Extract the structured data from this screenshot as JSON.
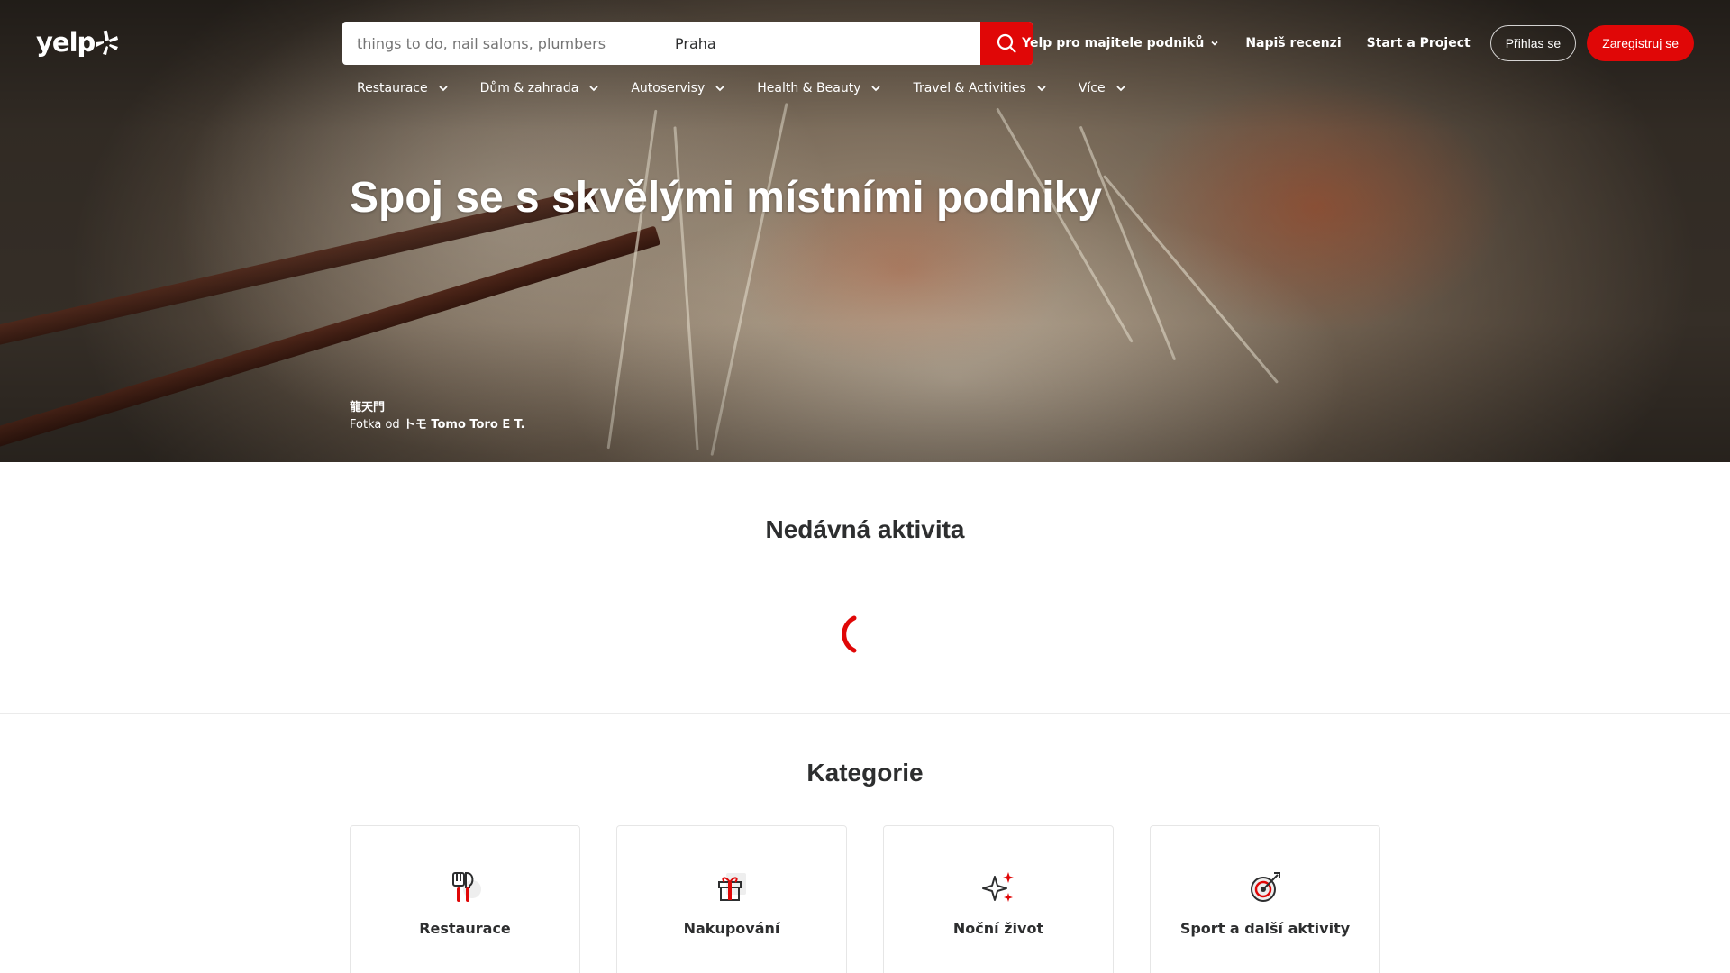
{
  "header": {
    "logo_text": "yelp",
    "search": {
      "find_placeholder": "things to do, nail salons, plumbers",
      "near_value": "Praha"
    },
    "nav": {
      "business": "Yelp pro majitele podniků",
      "write_review": "Napiš recenzi",
      "start_project": "Start a Project",
      "login": "Přihlas se",
      "signup": "Zaregistruj se"
    },
    "categories": [
      {
        "label": "Restaurace"
      },
      {
        "label": "Dům & zahrada"
      },
      {
        "label": "Autoservisy"
      },
      {
        "label": "Health & Beauty"
      },
      {
        "label": "Travel & Activities"
      },
      {
        "label": "Více"
      }
    ]
  },
  "hero": {
    "headline": "Spoj se s skvělými místními podniky",
    "photo_business": "龍天門",
    "photo_credit_prefix": "Fotka od",
    "photo_credit_user": "トモ Tomo Toro E T."
  },
  "recent_activity": {
    "title": "Nedávná aktivita"
  },
  "categories_section": {
    "title": "Kategorie",
    "cards": [
      {
        "label": "Restaurace",
        "icon": "utensils-icon"
      },
      {
        "label": "Nakupování",
        "icon": "gift-shopping-icon"
      },
      {
        "label": "Noční život",
        "icon": "sparkles-icon"
      },
      {
        "label": "Sport a další aktivity",
        "icon": "target-dart-icon"
      }
    ]
  },
  "colors": {
    "brand_red": "#e00707",
    "text_dark": "#2d2e2f"
  }
}
